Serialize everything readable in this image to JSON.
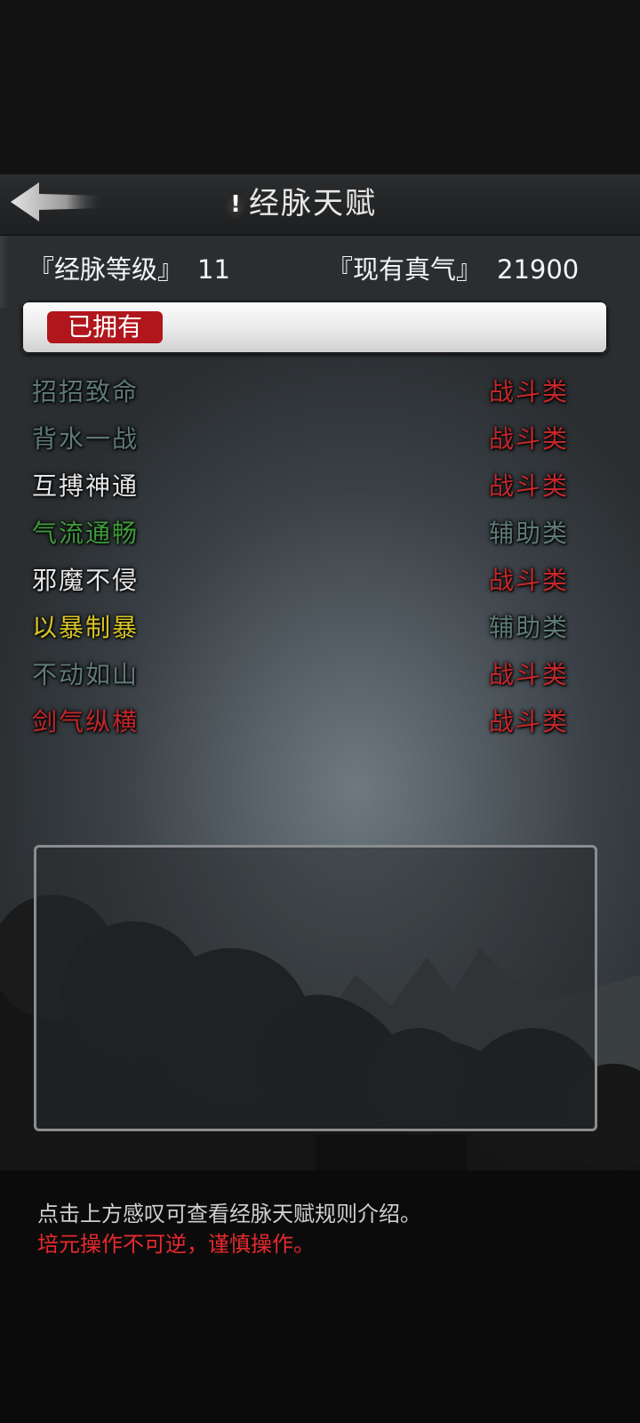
{
  "header": {
    "title": "经脉天赋",
    "info_symbol": "!"
  },
  "stats": {
    "level_label": "『经脉等级』",
    "level_value": "11",
    "qi_label": "『现有真气』",
    "qi_value": "21900"
  },
  "filter": {
    "owned_label": "已拥有"
  },
  "talents": [
    {
      "name": "招招致命",
      "type": "战斗类",
      "name_color": "#5e7a74",
      "type_color": "#c2282c"
    },
    {
      "name": "背水一战",
      "type": "战斗类",
      "name_color": "#5e7a74",
      "type_color": "#c2282c"
    },
    {
      "name": "互搏神通",
      "type": "战斗类",
      "name_color": "#e6e6e6",
      "type_color": "#c2282c"
    },
    {
      "name": "气流通畅",
      "type": "辅助类",
      "name_color": "#3e9a3a",
      "type_color": "#5e7a74"
    },
    {
      "name": "邪魔不侵",
      "type": "战斗类",
      "name_color": "#e6e6e6",
      "type_color": "#c2282c"
    },
    {
      "name": "以暴制暴",
      "type": "辅助类",
      "name_color": "#d8c428",
      "type_color": "#5e7a74"
    },
    {
      "name": "不动如山",
      "type": "战斗类",
      "name_color": "#5e7a74",
      "type_color": "#c2282c"
    },
    {
      "name": "剑气纵横",
      "type": "战斗类",
      "name_color": "#c2282c",
      "type_color": "#c2282c"
    }
  ],
  "footer": {
    "hint": "点击上方感叹可查看经脉天赋规则介绍。",
    "warning": "培元操作不可逆，谨慎操作。"
  },
  "colors": {
    "accent_red": "#b0161c",
    "warning_red": "#e8292c"
  },
  "icons": {
    "back": "back-arrow-icon",
    "info": "exclamation-icon"
  }
}
